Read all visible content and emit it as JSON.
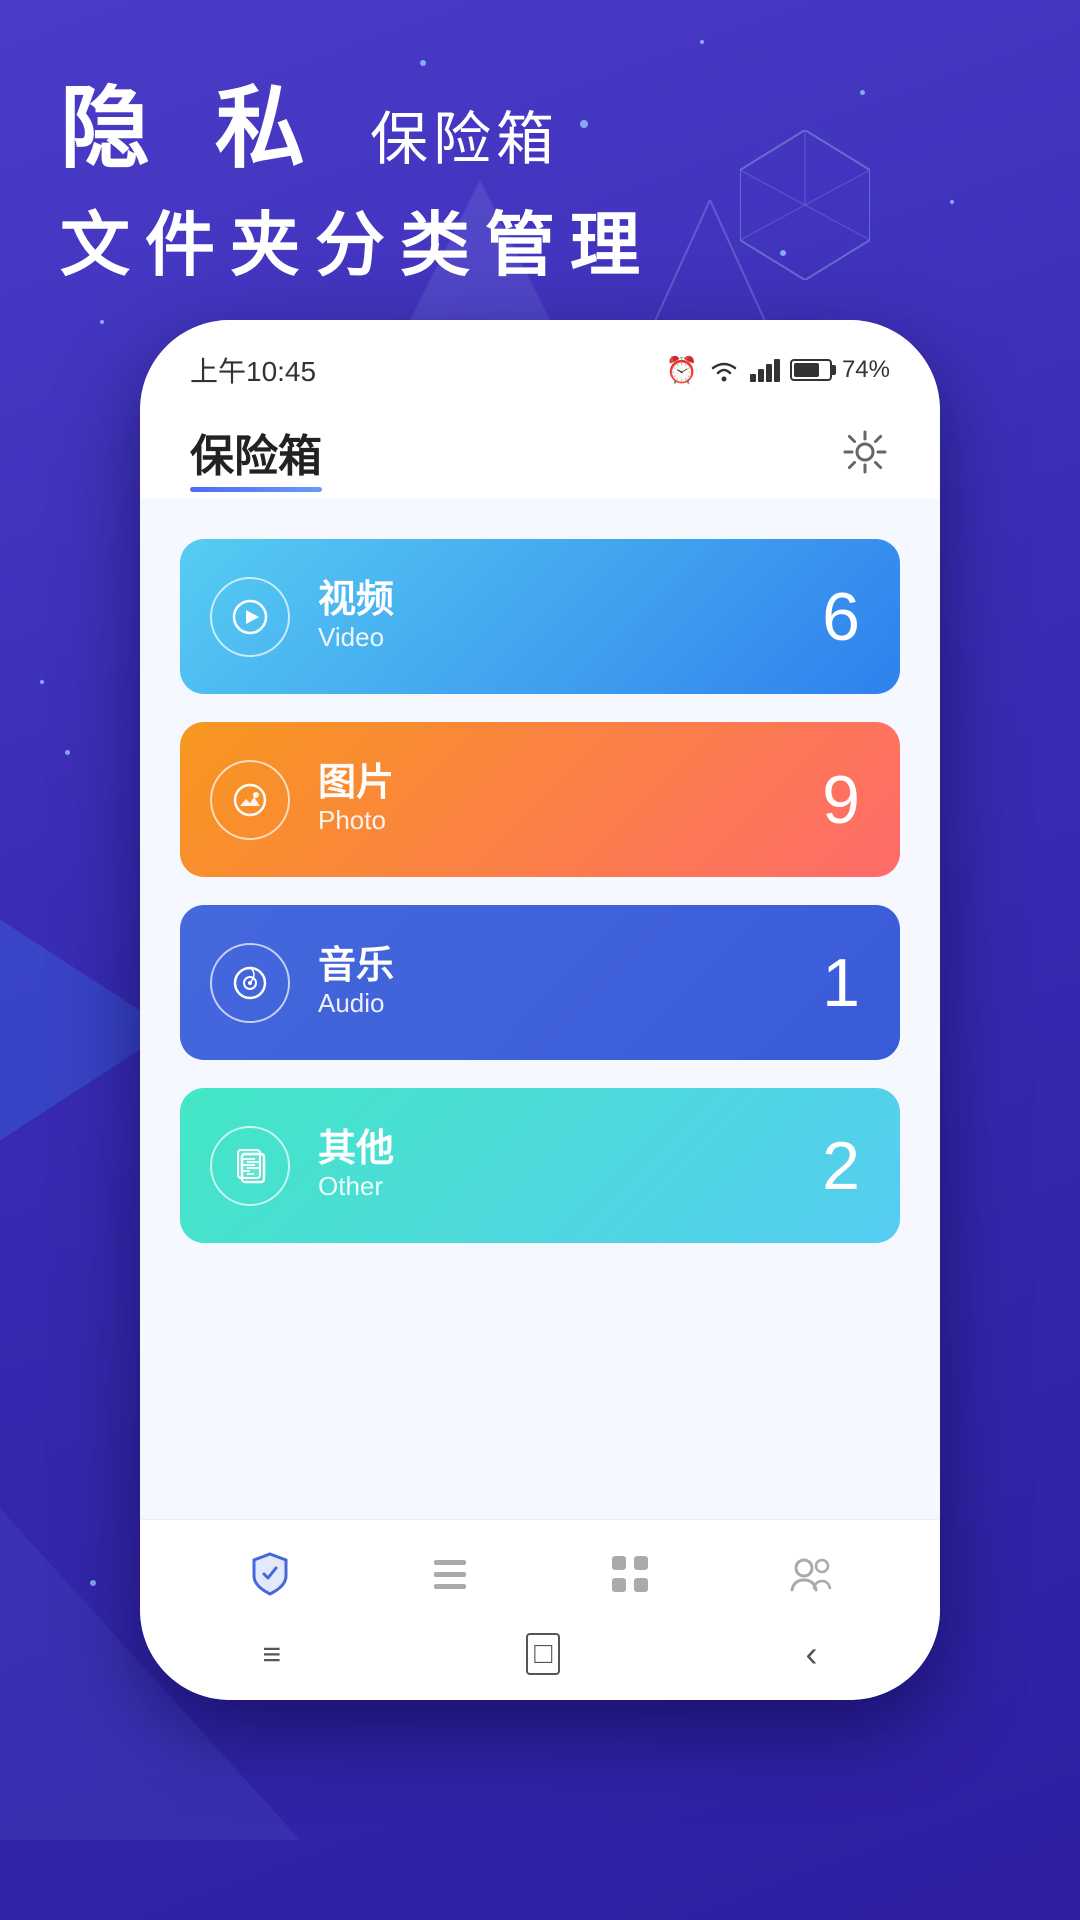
{
  "page": {
    "background": {
      "gradient_start": "#4a3cc7",
      "gradient_end": "#2d1fa0"
    }
  },
  "header": {
    "line1_bold": "隐 私",
    "line1_sub": "保险箱",
    "line2": "文件夹分类管理"
  },
  "statusbar": {
    "time": "上午10:45",
    "battery_percent": "74%"
  },
  "app": {
    "title": "保险箱",
    "title_underline_color": "#4a6cf7"
  },
  "categories": [
    {
      "id": "video",
      "label_zh": "视频",
      "label_en": "Video",
      "count": "6",
      "icon": "▶",
      "gradient_class": "card-video"
    },
    {
      "id": "photo",
      "label_zh": "图片",
      "label_en": "Photo",
      "count": "9",
      "icon": "◎",
      "gradient_class": "card-photo"
    },
    {
      "id": "audio",
      "label_zh": "音乐",
      "label_en": "Audio",
      "count": "1",
      "icon": "♫",
      "gradient_class": "card-audio"
    },
    {
      "id": "other",
      "label_zh": "其他",
      "label_en": "Other",
      "count": "2",
      "icon": "▣",
      "gradient_class": "card-other"
    }
  ],
  "bottom_nav": {
    "items": [
      {
        "id": "safe",
        "icon": "🛡",
        "active": true
      },
      {
        "id": "list",
        "icon": "≡",
        "active": false
      },
      {
        "id": "apps",
        "icon": "⠿",
        "active": false
      },
      {
        "id": "contacts",
        "icon": "👥",
        "active": false
      }
    ]
  },
  "android_nav": {
    "menu": "≡",
    "home": "□",
    "back": "‹"
  }
}
